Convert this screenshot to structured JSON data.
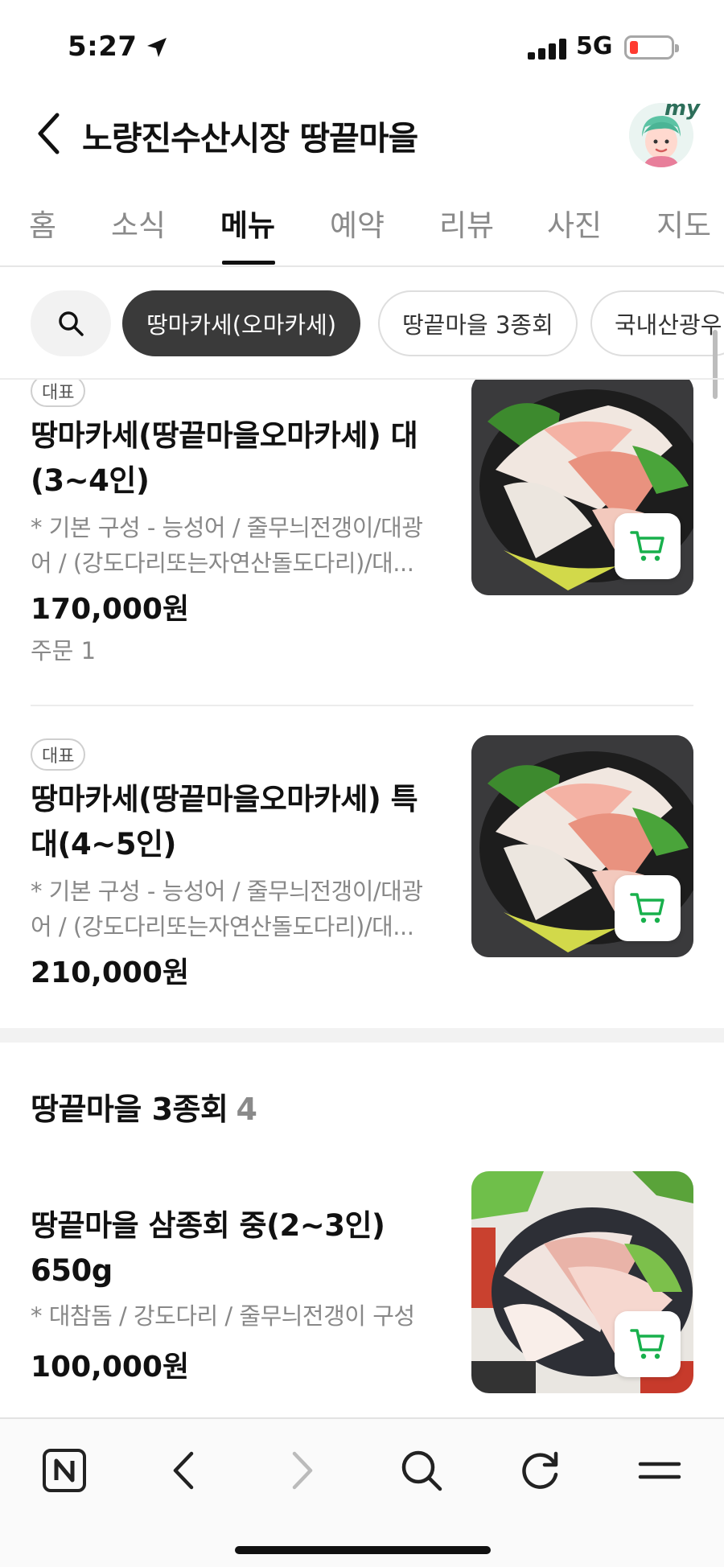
{
  "status_bar": {
    "time": "5:27",
    "network": "5G"
  },
  "header": {
    "title": "노량진수산시장 땅끝마을",
    "avatar_text": "my"
  },
  "tabs": [
    {
      "label": "홈"
    },
    {
      "label": "소식"
    },
    {
      "label": "메뉴"
    },
    {
      "label": "예약"
    },
    {
      "label": "리뷰"
    },
    {
      "label": "사진"
    },
    {
      "label": "지도"
    }
  ],
  "active_tab": "메뉴",
  "chips": [
    {
      "label": "땅마카세(오마카세)"
    },
    {
      "label": "땅끝마을 3종회"
    },
    {
      "label": "국내산광우"
    }
  ],
  "menu_items": [
    {
      "badge": "대표",
      "name_line1": "땅마카세(땅끝마을오마카세) 대",
      "name_line2": "(3~4인)",
      "desc_line1": "* 기본 구성 - 능성어 / 줄무늬전갱이/대광",
      "desc_line2": "어 / (강도다리또는자연산돌도다리)/대...",
      "price": "170,000원",
      "orders": "주문 1"
    },
    {
      "badge": "대표",
      "name_line1": "땅마카세(땅끝마을오마카세) 특",
      "name_line2": "대(4~5인)",
      "desc_line1": "* 기본 구성 - 능성어 / 줄무늬전갱이/대광",
      "desc_line2": "어 / (강도다리또는자연산돌도다리)/대...",
      "price": "210,000원"
    }
  ],
  "section": {
    "title": "땅끝마을 3종회",
    "count": "4",
    "item": {
      "name_line1": "땅끝마을 삼종회 중(2~3인)",
      "name_line2": "650g",
      "desc_line1": "* 대참돔 / 강도다리 / 줄무늬전갱이 구성",
      "price": "100,000원"
    }
  },
  "colors": {
    "accent_green": "#18b04c",
    "active_chip": "#3a3a3a",
    "muted_text": "#888888"
  },
  "icons": [
    "location-arrow-icon",
    "signal-icon",
    "battery-icon",
    "back-chevron-icon",
    "search-icon",
    "cart-icon",
    "naver-n-icon",
    "browser-back-icon",
    "browser-forward-icon",
    "browser-search-icon",
    "refresh-icon",
    "menu-icon"
  ]
}
